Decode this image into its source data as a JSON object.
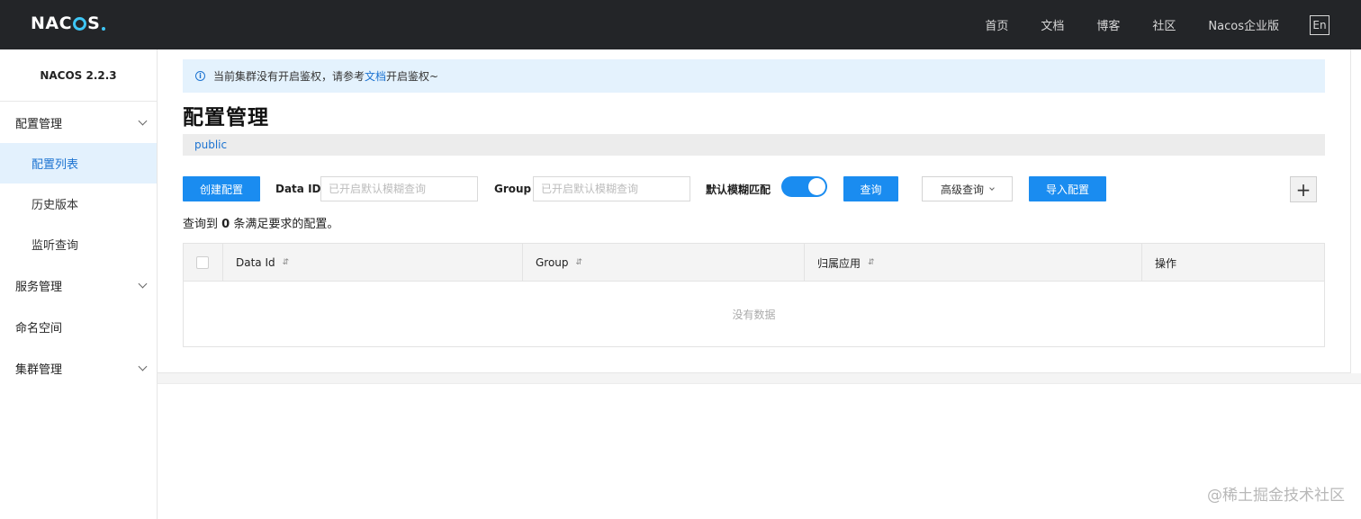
{
  "header": {
    "logo_pre": "NAC",
    "logo_post": "S",
    "nav": [
      "首页",
      "文档",
      "博客",
      "社区",
      "Nacos企业版"
    ],
    "lang": "En"
  },
  "sidebar": {
    "version": "NACOS 2.2.3",
    "items": [
      {
        "label": "配置管理",
        "type": "group"
      },
      {
        "label": "配置列表",
        "type": "sub",
        "active": true
      },
      {
        "label": "历史版本",
        "type": "sub"
      },
      {
        "label": "监听查询",
        "type": "sub"
      },
      {
        "label": "服务管理",
        "type": "group"
      },
      {
        "label": "命名空间",
        "type": "group"
      },
      {
        "label": "集群管理",
        "type": "group"
      }
    ]
  },
  "notice": {
    "pre": "当前集群没有开启鉴权，请参考",
    "link": "文档",
    "post": "开启鉴权~"
  },
  "main": {
    "title": "配置管理",
    "namespace": "public",
    "toolbar": {
      "create_label": "创建配置",
      "data_id_label": "Data ID",
      "data_id_placeholder": "已开启默认模糊查询",
      "group_label": "Group",
      "group_placeholder": "已开启默认模糊查询",
      "fuzzy_label": "默认模糊匹配",
      "search_label": "查询",
      "advanced_label": "高级查询",
      "import_label": "导入配置",
      "plus": "+"
    },
    "result": {
      "pre": "查询到 ",
      "count": "0",
      "post": " 条满足要求的配置。"
    },
    "table": {
      "columns": [
        "Data Id",
        "Group",
        "归属应用",
        "操作"
      ],
      "sort_glyph": "⇵",
      "empty": "没有数据"
    }
  },
  "watermark": "@稀土掘金技术社区",
  "colors": {
    "header_bg": "#232528",
    "primary": "#1a8cf0",
    "link": "#1c73d1",
    "notice_bg": "#e4f2fd",
    "active_bg": "#e3f1fd"
  }
}
